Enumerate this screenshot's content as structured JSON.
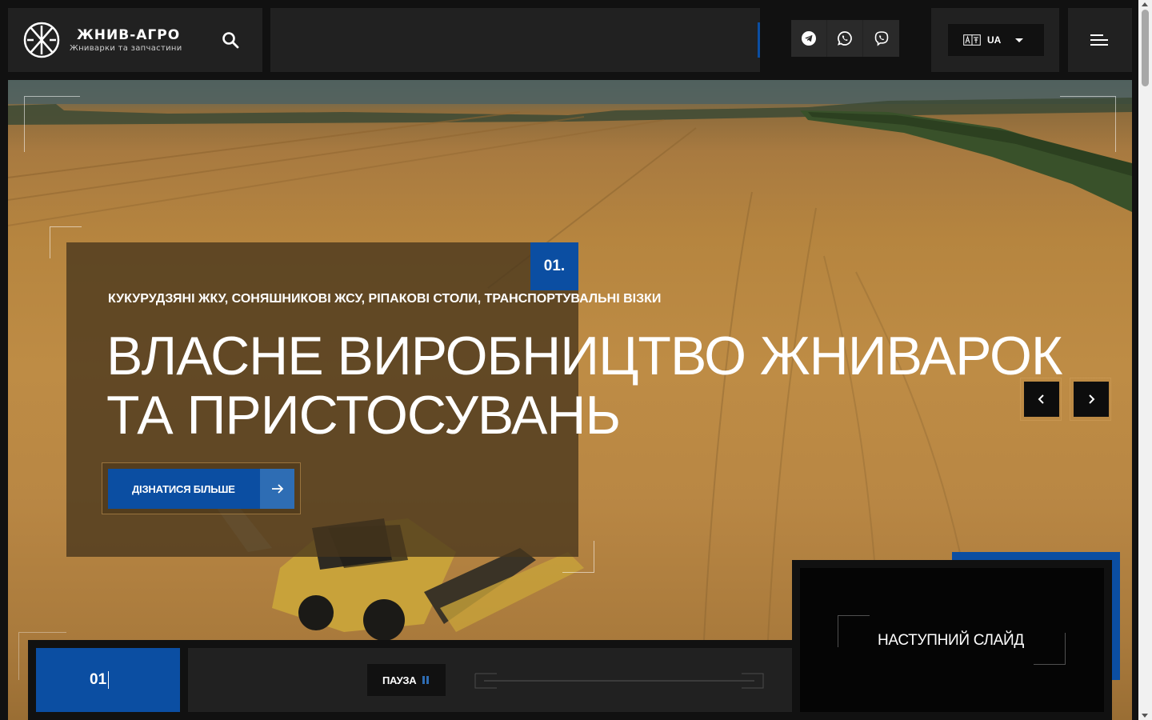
{
  "brand": {
    "title": "ЖНИВ-АГРО",
    "subtitle": "Жниварки та запчастини"
  },
  "header": {
    "search_icon": "search-icon",
    "social": [
      {
        "name": "telegram",
        "icon": "telegram-icon"
      },
      {
        "name": "whatsapp",
        "icon": "whatsapp-icon"
      },
      {
        "name": "viber",
        "icon": "viber-icon"
      }
    ],
    "language": {
      "icon": "translate-icon",
      "selected": "UA"
    },
    "menu_icon": "hamburger-menu-icon"
  },
  "hero": {
    "slide_number": "01.",
    "subtitle": "КУКУРУДЗЯНІ ЖКУ, СОНЯШНИКОВІ ЖСУ, РІПАКОВІ СТОЛИ, ТРАНСПОРТУВАЛЬНІ ВІЗКИ",
    "title_line1": "ВЛАСНЕ ВИРОБНИЦТВО ЖНИВАРОК",
    "title_line2": "ТА ПРИСТОСУВАНЬ",
    "cta_label": "ДІЗНАТИСЯ БІЛЬШЕ",
    "prev_icon": "chevron-left-icon",
    "next_icon": "chevron-right-icon"
  },
  "slider_controls": {
    "counter": "01",
    "pause_label": "ПАУЗА",
    "next_slide_label": "НАСТУПНИЙ СЛАЙД"
  },
  "colors": {
    "accent_blue": "#0b4ea2",
    "panel_dark": "#212121",
    "page_bg": "#111111"
  }
}
